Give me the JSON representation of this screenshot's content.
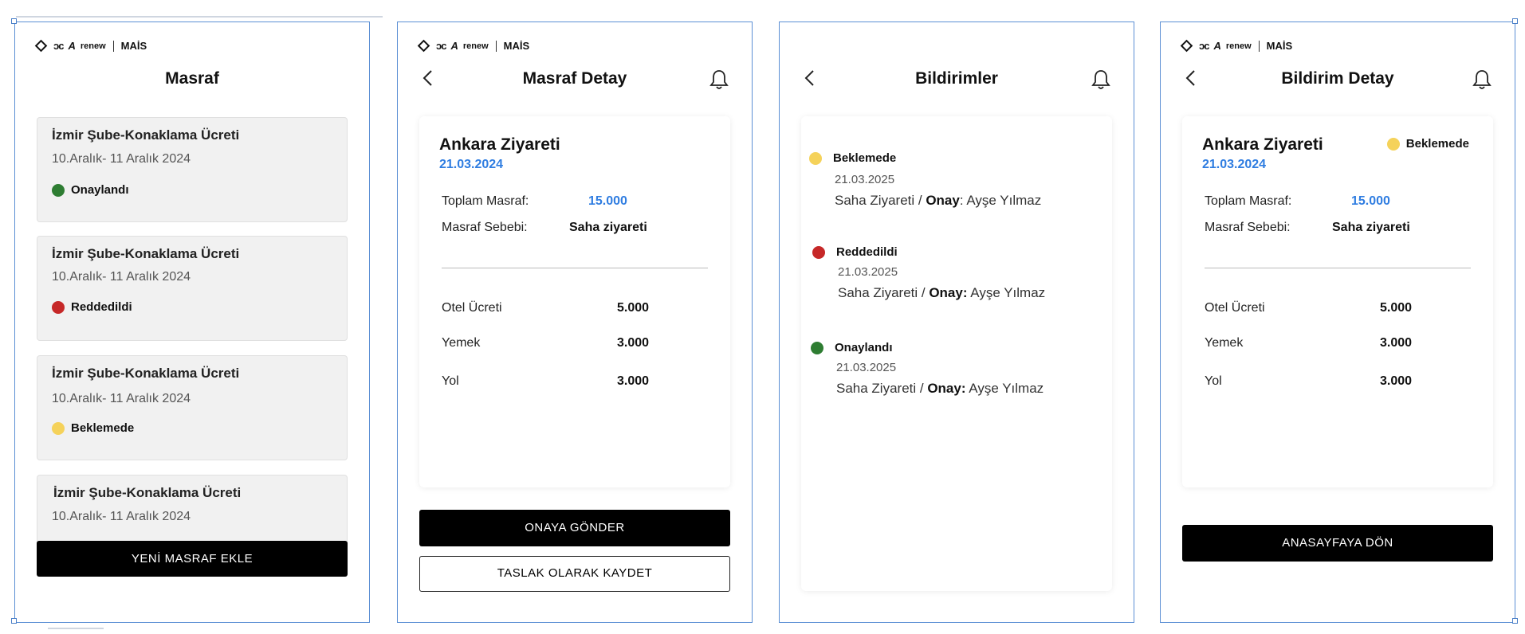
{
  "brand": {
    "dc": "ɔc",
    "alpine": "A",
    "renew": "renew",
    "mais": "MAİS"
  },
  "screens": [
    {
      "title": "Masraf",
      "cards": [
        {
          "title": "İzmir Şube-Konaklama Ücreti",
          "date": "10.Aralık- 11 Aralık 2024",
          "status": "Onaylandı",
          "color": "#2e7d32"
        },
        {
          "title": "İzmir Şube-Konaklama Ücreti",
          "date": "10.Aralık- 11 Aralık 2024",
          "status": "Reddedildi",
          "color": "#c62828"
        },
        {
          "title": "İzmir Şube-Konaklama Ücreti",
          "date": "10.Aralık- 11 Aralık 2024",
          "status": "Beklemede",
          "color": "#f5d25a"
        },
        {
          "title": "İzmir Şube-Konaklama Ücreti",
          "date": "10.Aralık- 11 Aralık 2024"
        }
      ],
      "button": "YENİ MASRAF EKLE"
    },
    {
      "title": "Masraf Detay",
      "name": "Ankara Ziyareti",
      "date": "21.03.2024",
      "total_label": "Toplam Masraf:",
      "total_value": "15.000",
      "reason_label": "Masraf Sebebi:",
      "reason_value": "Saha ziyareti",
      "items": [
        {
          "label": "Otel Ücreti",
          "value": "5.000"
        },
        {
          "label": "Yemek",
          "value": "3.000"
        },
        {
          "label": "Yol",
          "value": "3.000"
        }
      ],
      "primary_button": "ONAYA GÖNDER",
      "secondary_button": "TASLAK OLARAK KAYDET"
    },
    {
      "title": "Bildirimler",
      "notifications": [
        {
          "status": "Beklemede",
          "date": "21.03.2025",
          "prefix": "Saha Ziyareti / ",
          "onay": "Onay",
          "suffix": ": Ayşe Yılmaz",
          "color": "#f5d25a"
        },
        {
          "status": "Reddedildi",
          "date": "21.03.2025",
          "prefix": "Saha Ziyareti / ",
          "onay": "Onay:",
          "suffix": " Ayşe Yılmaz",
          "color": "#c62828"
        },
        {
          "status": "Onaylandı",
          "date": "21.03.2025",
          "prefix": "Saha Ziyareti / ",
          "onay": "Onay:",
          "suffix": " Ayşe Yılmaz",
          "color": "#2e7d32"
        }
      ]
    },
    {
      "title": "Bildirim Detay",
      "name": "Ankara Ziyareti",
      "date": "21.03.2024",
      "status": "Beklemede",
      "total_label": "Toplam Masraf:",
      "total_value": "15.000",
      "reason_label": "Masraf Sebebi:",
      "reason_value": "Saha ziyareti",
      "items": [
        {
          "label": "Otel Ücreti",
          "value": "5.000"
        },
        {
          "label": "Yemek",
          "value": "3.000"
        },
        {
          "label": "Yol",
          "value": "3.000"
        }
      ],
      "button": "ANASAYFAYA DÖN"
    }
  ]
}
